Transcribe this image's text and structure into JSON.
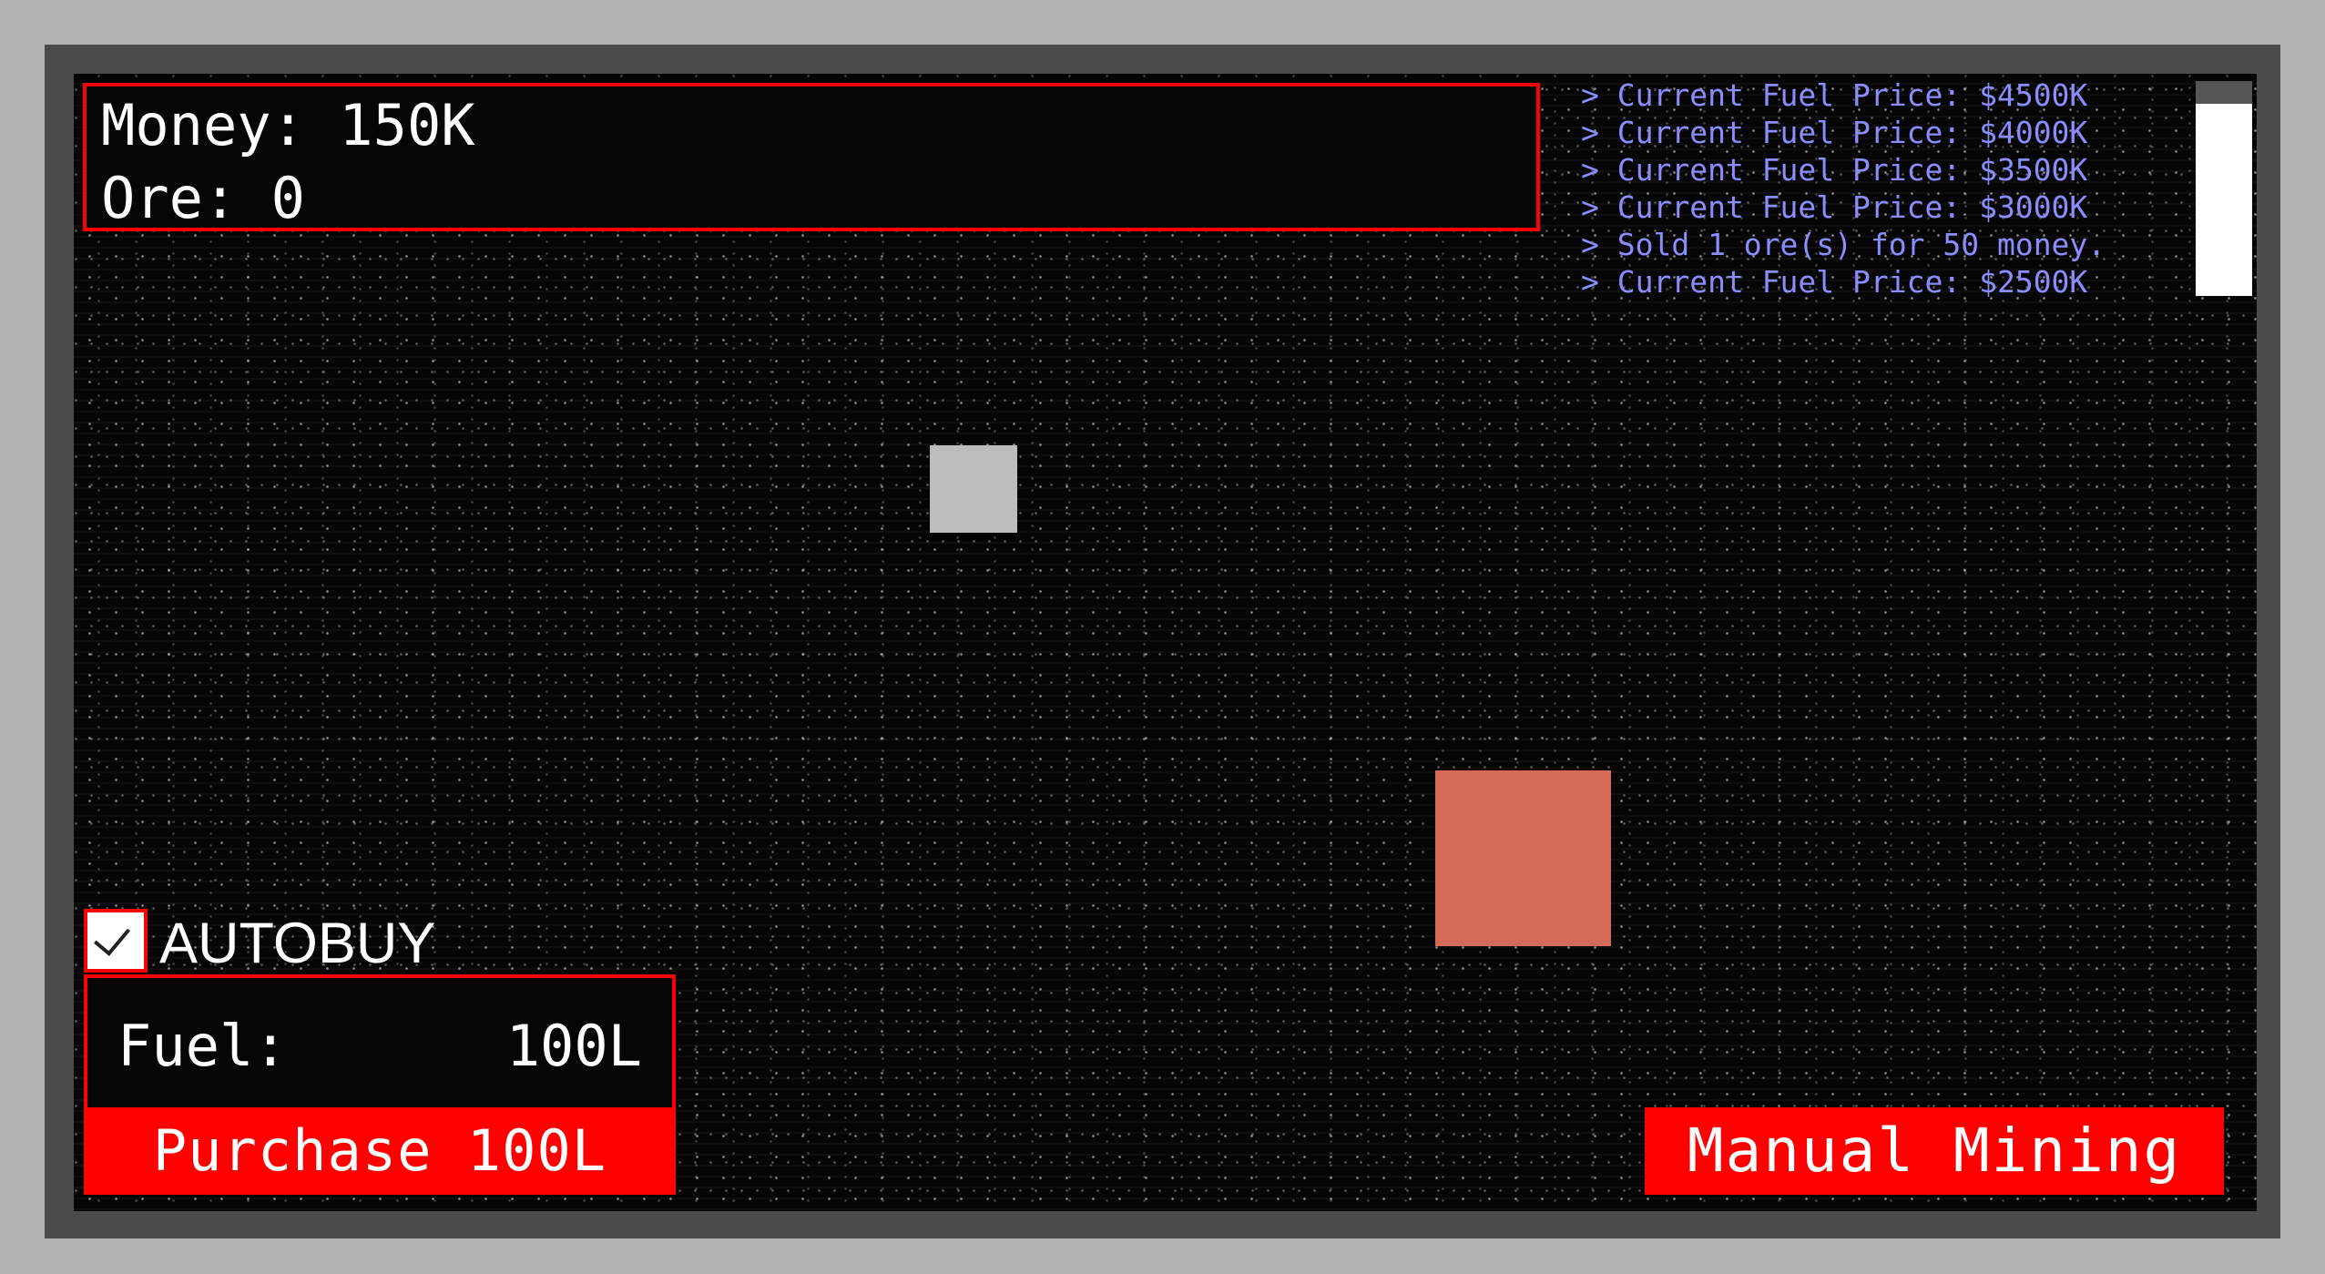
{
  "stats": {
    "money_label": "Money:",
    "money_value": "150K",
    "ore_label": "Ore:",
    "ore_value": "0"
  },
  "log": {
    "entries": [
      "> Current Fuel Price: $4500K",
      "> Current Fuel Price: $4000K",
      "> Current Fuel Price: $3500K",
      "> Current Fuel Price: $3000K",
      "> Sold 1 ore(s) for 50 money.",
      "> Current Fuel Price: $2500K"
    ]
  },
  "autobuy": {
    "label": "AUTOBUY",
    "checked": true
  },
  "fuel": {
    "label": "Fuel:",
    "value": "100L"
  },
  "buttons": {
    "purchase_label": "Purchase 100L",
    "manual_mining_label": "Manual Mining"
  },
  "colors": {
    "accent": "#ff0000",
    "log_text": "#8c8cff",
    "ore_asteroid": "#bdbdbd",
    "miner_ship": "#d56a58",
    "background": "#050505",
    "frame": "#4b4b4b"
  }
}
